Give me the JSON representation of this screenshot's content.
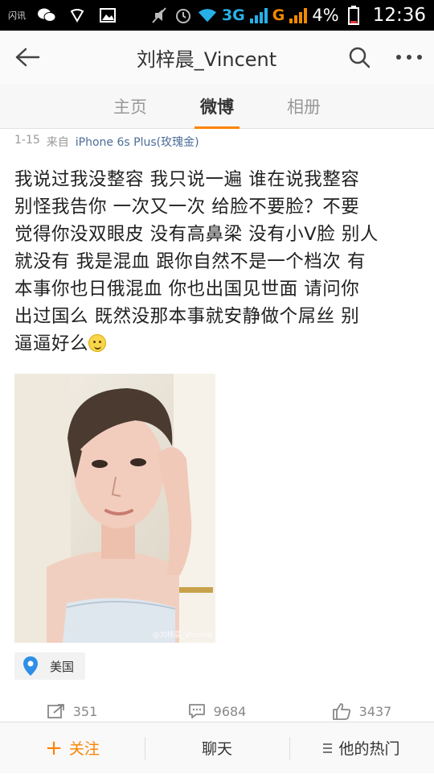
{
  "status_bar": {
    "carrier": "闪讯",
    "network_3g": "3G",
    "network_g": "G",
    "battery_percent": "4%",
    "time": "12:36"
  },
  "titlebar": {
    "title": "刘梓晨_Vincent",
    "back_icon": "back-arrow-icon",
    "search_icon": "search-icon",
    "more_icon": "more-icon"
  },
  "tabs": [
    {
      "label": "主页",
      "active": false
    },
    {
      "label": "微博",
      "active": true
    },
    {
      "label": "相册",
      "active": false
    }
  ],
  "post": {
    "date": "1-15",
    "source_prefix": "来自",
    "source": "iPhone 6s Plus(玫瑰金)",
    "lines": [
      "我说过我没整容 我只说一遍 谁在说我整容",
      "别怪我告你 一次又一次 给脸不要脸？不要",
      "觉得你没双眼皮 没有高鼻梁 没有小V脸 别人",
      "就没有 我是混血 跟你自然不是一个档次 有",
      "本事你也日俄混血 你也出国见世面 请问你",
      "出过国么 既然没那本事就安静做个屌丝 别",
      "逼逼好么"
    ],
    "emoji": "smiley-icon",
    "image_watermark": "@刘梓晨_Vincent",
    "location": "美国"
  },
  "actions": {
    "repost_count": "351",
    "comment_count": "9684",
    "like_count": "3437"
  },
  "bottom_bar": {
    "follow": "关注",
    "chat": "聊天",
    "hot": "他的热门"
  },
  "colors": {
    "accent": "#ff8200",
    "link": "#4c6d99"
  }
}
